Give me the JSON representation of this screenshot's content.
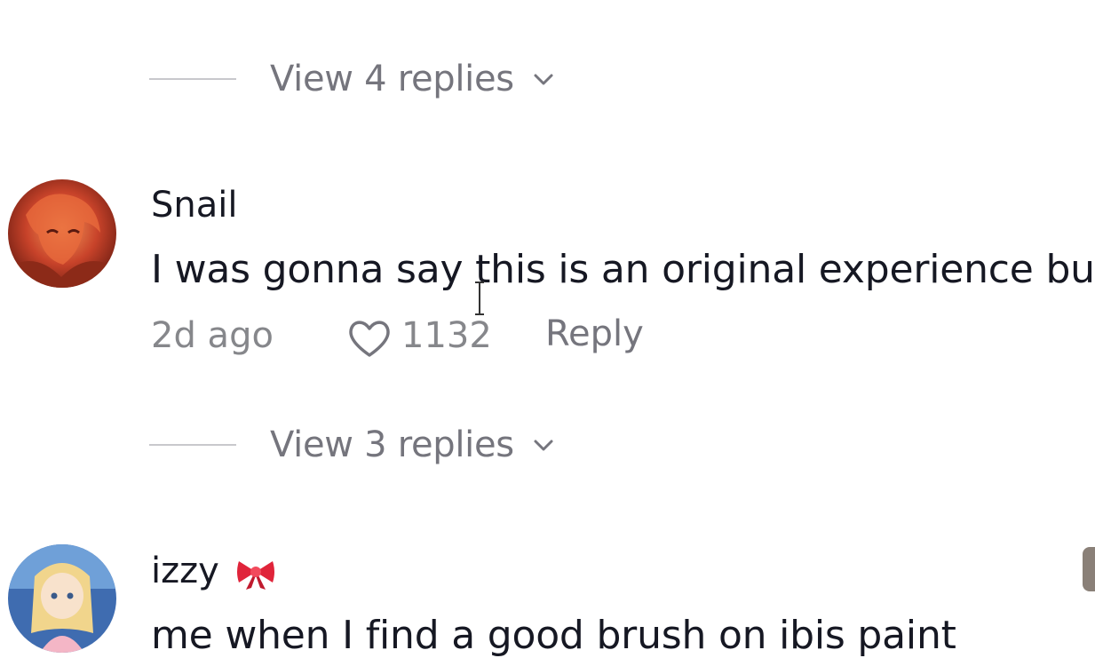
{
  "thread": {
    "view_replies_top": {
      "label": "View 4 replies"
    },
    "comment": {
      "username": "Snail",
      "text": "I was gonna say this is an original experience bu",
      "time": "2d ago",
      "likes": "1132",
      "reply_label": "Reply"
    },
    "view_replies_mid": {
      "label": "View 3 replies"
    },
    "next_comment": {
      "username": "izzy",
      "badge_icon": "ribbon-bow-emoji",
      "text": "me when I find a good brush on ibis paint"
    }
  },
  "colors": {
    "text_primary": "#161823",
    "text_secondary": "#75757d",
    "accent_bow": "#e0243a"
  }
}
